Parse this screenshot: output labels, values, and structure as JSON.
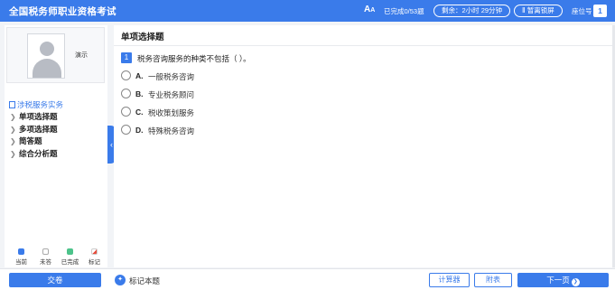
{
  "header": {
    "title": "全国税务师职业资格考试",
    "font_icon": "A",
    "progress": "已完成0/53题",
    "timer": "剩余：2小时 29分钟",
    "pause": "Ⅱ 暂离锁屏",
    "seat_label": "座位号",
    "seat_number": "1"
  },
  "sidebar": {
    "candidate_name": "演示",
    "section_title": "涉税服务实务",
    "items": [
      {
        "label": "单项选择题"
      },
      {
        "label": "多项选择题"
      },
      {
        "label": "简答题"
      },
      {
        "label": "综合分析题"
      }
    ],
    "legend": [
      {
        "label": "当前"
      },
      {
        "label": "未答"
      },
      {
        "label": "已完成"
      },
      {
        "label": "标记"
      }
    ]
  },
  "question": {
    "type_title": "单项选择题",
    "number": "1",
    "stem": "税务咨询服务的种类不包括（    ）。",
    "options": [
      {
        "letter": "A.",
        "text": "一般税务咨询"
      },
      {
        "letter": "B.",
        "text": "专业税务顾问"
      },
      {
        "letter": "C.",
        "text": "税收策划服务"
      },
      {
        "letter": "D.",
        "text": "特殊税务咨询"
      }
    ]
  },
  "footer": {
    "submit": "交卷",
    "mark": "标记本题",
    "calculator": "计算器",
    "appendix": "附表",
    "next": "下一页"
  },
  "colors": {
    "primary": "#3a7bea",
    "done": "#4cc38a",
    "mark": "#e74c3c"
  }
}
